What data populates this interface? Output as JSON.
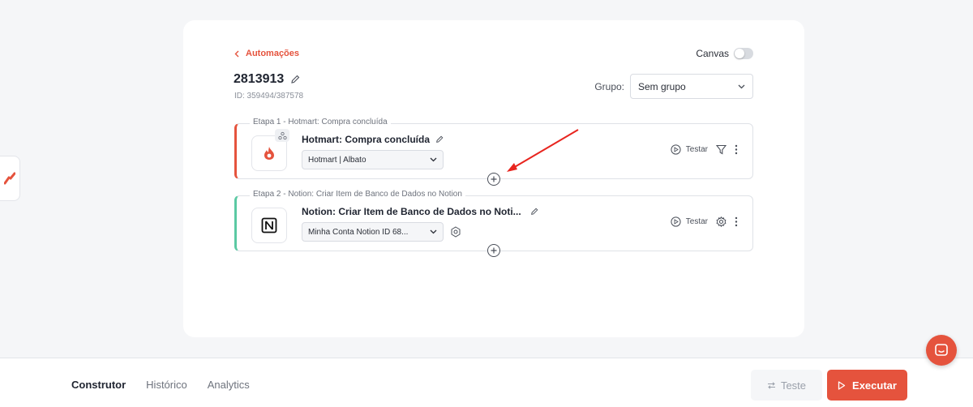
{
  "header": {
    "back_label": "Automações",
    "canvas_label": "Canvas",
    "canvas_enabled": false,
    "automation_title": "2813913",
    "automation_id": "ID: 359494/387578",
    "group_label": "Grupo:",
    "group_value": "Sem grupo"
  },
  "steps": [
    {
      "label": "Etapa 1 - Hotmart: Compra concluída",
      "name": "Hotmart: Compra concluída",
      "account": "Hotmart | Albato",
      "test_label": "Testar",
      "accent": "#e5533d"
    },
    {
      "label": "Etapa 2 - Notion: Criar Item de Banco de Dados no Notion",
      "name": "Notion: Criar Item de Banco de Dados no Noti...",
      "account": "Minha Conta Notion ID 68...",
      "test_label": "Testar",
      "accent": "#5bc9a3"
    }
  ],
  "footer": {
    "tabs": [
      "Construtor",
      "Histórico",
      "Analytics"
    ],
    "active_tab": "Construtor",
    "test_button": "Teste",
    "run_button": "Executar"
  },
  "colors": {
    "brand": "#e5533d",
    "notion_accent": "#5bc9a3"
  },
  "icons": {
    "back": "chevron-left-icon",
    "edit": "pencil-icon",
    "dropdown": "chevron-down-icon",
    "test": "play-circle-icon",
    "filter": "filter-icon",
    "more": "kebab-icon",
    "settings": "gear-icon",
    "add": "plus-circle-icon",
    "chat": "chat-icon"
  }
}
